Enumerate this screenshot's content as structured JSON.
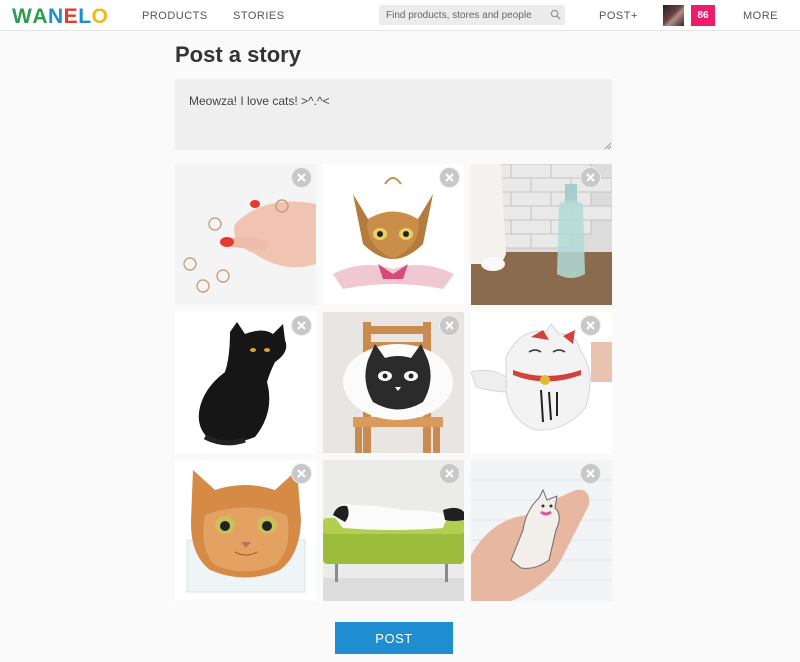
{
  "nav": {
    "logo": [
      "W",
      "A",
      "N",
      "E",
      "L",
      "O"
    ],
    "logo_colors": [
      "#2a9d4f",
      "#2a9d4f",
      "#1f8ed0",
      "#e63a2a",
      "#1f8ed0",
      "#f2b71a"
    ],
    "products": "PRODUCTS",
    "stories": "STORIES",
    "search_placeholder": "Find products, stores and people",
    "post": "POST+",
    "badge_count": "86",
    "more": "MORE"
  },
  "page": {
    "title": "Post a story",
    "story_text": "Meowza! I love cats! >^.^<",
    "post_button": "POST"
  },
  "images": [
    {
      "subject": "cat ears rings on hand"
    },
    {
      "subject": "cat face pendant"
    },
    {
      "subject": "cat paws and glass bottle"
    },
    {
      "subject": "black cat"
    },
    {
      "subject": "cat pillow on wooden chair"
    },
    {
      "subject": "lucky cat teapot"
    },
    {
      "subject": "orange cat face coin purse"
    },
    {
      "subject": "cat lying on green bench"
    },
    {
      "subject": "cat sticker in hand"
    }
  ],
  "colors": {
    "accent_blue": "#1f8ed0",
    "badge_pink": "#ec1d6b"
  }
}
